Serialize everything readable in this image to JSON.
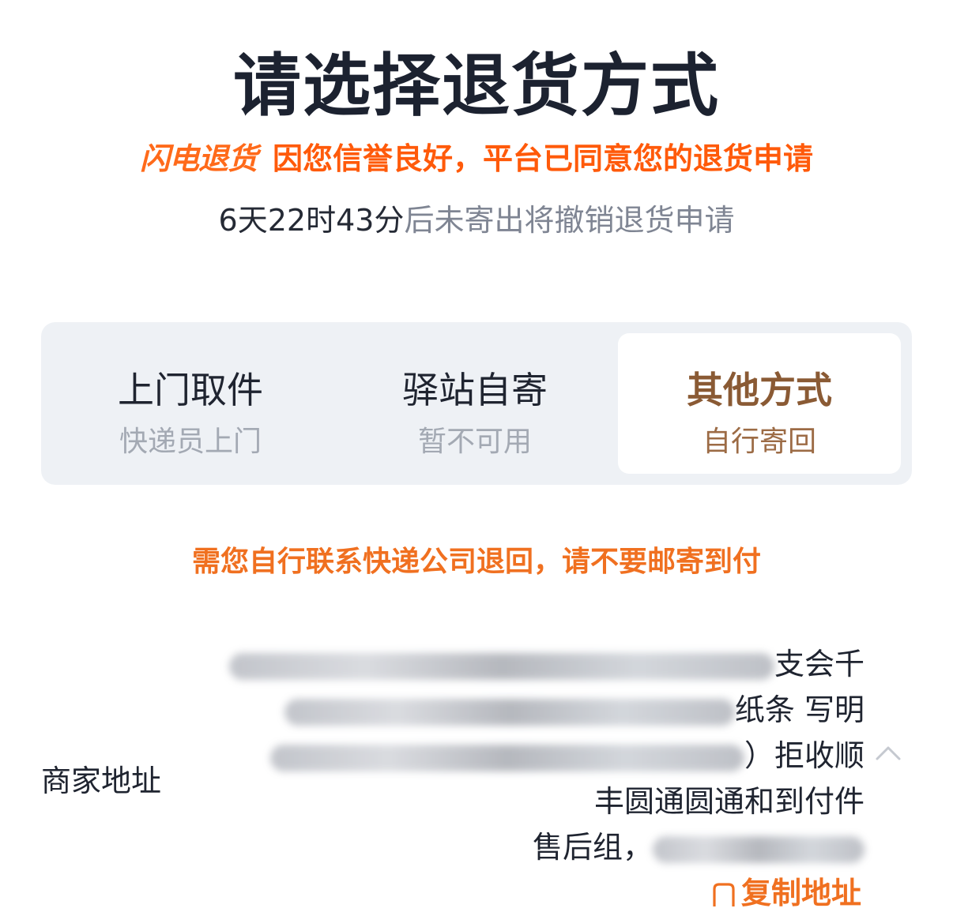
{
  "page_title": "请选择退货方式",
  "flash": {
    "badge": "闪电退货",
    "text": "因您信誉良好，平台已同意您的退货申请"
  },
  "deadline": {
    "time": "6天22时43分",
    "text": "后未寄出将撤销退货申请"
  },
  "methods": [
    {
      "title": "上门取件",
      "desc": "快递员上门",
      "selected": false
    },
    {
      "title": "驿站自寄",
      "desc": "暂不可用",
      "selected": false
    },
    {
      "title": "其他方式",
      "desc": "自行寄回",
      "selected": true
    }
  ],
  "notice": "需您自行联系快递公司退回，请不要邮寄到付",
  "address": {
    "label": "商家地址",
    "lines": [
      {
        "visible": "支会千"
      },
      {
        "visible": "纸条 写明"
      },
      {
        "visible": "）拒收顺"
      },
      {
        "visible": "丰圆通圆通和到付件"
      },
      {
        "visible": "售后组，"
      }
    ]
  },
  "copy_label": "复制地址",
  "colors": {
    "accent": "#ff6a1a",
    "selected_tab_text": "#8a5a34",
    "tab_bg": "#eef1f5"
  },
  "icons": {
    "expand": "chevron-up-icon",
    "copy": "copy-icon"
  }
}
